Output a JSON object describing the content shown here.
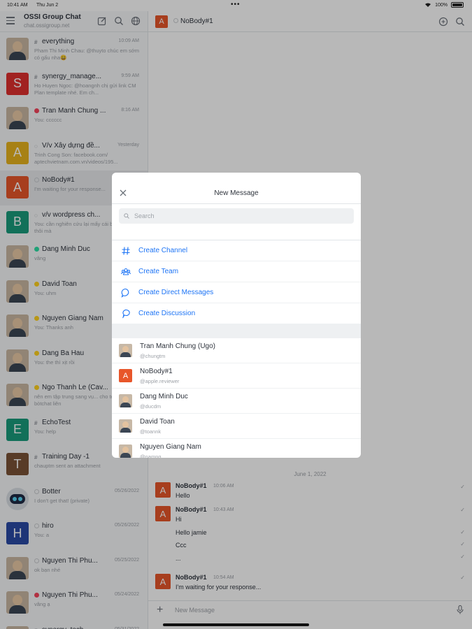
{
  "status_bar": {
    "time": "10:41 AM",
    "date": "Thu Jun 2",
    "battery": "100%"
  },
  "workspace": {
    "title": "OSSI Group Chat",
    "url": "chat.ossigroup.net"
  },
  "rooms": [
    {
      "name": "everything",
      "type": "channel",
      "time": "10:09 AM",
      "message": "Pham Thi Minh Chau: @thuyto chúc em sớm có gấu nha😄",
      "avatar": "photo"
    },
    {
      "name": "synergy_manage...",
      "type": "channel",
      "time": "9:59 AM",
      "message": "Ho Huyen Ngoc: @hoangnh chị gửi link CM Plan template nhé. Em ch...",
      "avatar": "S",
      "color": "#e0302f"
    },
    {
      "name": "Tran Manh Chung ...",
      "type": "dm",
      "status": "busy",
      "time": "8:16 AM",
      "message": "You: cccccc",
      "avatar": "photo"
    },
    {
      "name": "V/v Xây dựng đề...",
      "type": "discussion",
      "time": "Yesterday",
      "message": "Trinh Cong Son: facebook.com/ aptechvietnam.com.vn/videos/195...",
      "avatar": "A",
      "color": "#e8b31e"
    },
    {
      "name": "NoBody#1",
      "type": "dm",
      "status": "offline",
      "time": "",
      "message": "I'm waiting for your response...",
      "avatar": "A",
      "color": "#e8562a",
      "active": true
    },
    {
      "name": "v/v wordpress ch...",
      "type": "discussion",
      "time": "",
      "message": "You: cần nghiên cứu lại mấy cái backup đã thôi mà",
      "avatar": "B",
      "color": "#1a9b7c"
    },
    {
      "name": "Dang Minh Duc",
      "type": "dm",
      "status": "online",
      "time": "",
      "message": "vâng",
      "avatar": "photo"
    },
    {
      "name": "David Toan",
      "type": "dm",
      "status": "away",
      "time": "",
      "message": "You: uhm",
      "avatar": "photo"
    },
    {
      "name": "Nguyen Giang Nam",
      "type": "dm",
      "status": "away",
      "time": "",
      "message": "You: Thanks anh",
      "avatar": "photo"
    },
    {
      "name": "Dang Ba Hau",
      "type": "dm",
      "status": "away",
      "time": "",
      "message": "You: the thì xịt rồi",
      "avatar": "photo"
    },
    {
      "name": "Ngo Thanh Le (Cav...",
      "type": "dm",
      "status": "away",
      "time": "",
      "message": "nên em tập trung sang vụ... cho team, xà bòtchat liên",
      "avatar": "photo"
    },
    {
      "name": "EchoTest",
      "type": "channel",
      "time": "",
      "message": "You: help",
      "avatar": "E",
      "color": "#1a9b7c"
    },
    {
      "name": "Training Day -1",
      "type": "channel",
      "time": "",
      "message": "chauptm sent an attachment",
      "avatar": "T",
      "color": "#7a5236"
    },
    {
      "name": "Botter",
      "type": "dm",
      "status": "offline",
      "time": "05/26/2022",
      "message": "I don't get that! (private)",
      "avatar": "bot"
    },
    {
      "name": "hiro",
      "type": "dm",
      "status": "offline",
      "time": "05/26/2022",
      "message": "You: a",
      "avatar": "H",
      "color": "#2a4aa6"
    },
    {
      "name": "Nguyen Thi Phu...",
      "type": "dm",
      "status": "offline",
      "time": "05/25/2022",
      "message": "ok bạn nhé",
      "avatar": "photo"
    },
    {
      "name": "Nguyen Thi Phu...",
      "type": "dm",
      "status": "busy",
      "time": "05/24/2022",
      "message": "vâng ạ",
      "avatar": "photo"
    },
    {
      "name": "synergy_tech...",
      "type": "channel",
      "time": "05/31/2022",
      "message": "",
      "avatar": "photo"
    }
  ],
  "room_header": {
    "title": "NoBody#1",
    "avatar": "A"
  },
  "chat": {
    "day_separator": "June 1, 2022",
    "messages": [
      {
        "author": "NoBody#1",
        "time": "10:06 AM",
        "lines": [
          "Hello"
        ]
      },
      {
        "author": "NoBody#1",
        "time": "10:43 AM",
        "lines": [
          "Hi",
          "Hello jamie",
          "Ccc",
          "..."
        ]
      },
      {
        "author": "NoBody#1",
        "time": "10:54 AM",
        "lines": [
          "I'm waiting for your response..."
        ]
      }
    ]
  },
  "composer": {
    "placeholder": "New Message"
  },
  "modal": {
    "title": "New Message",
    "search_placeholder": "Search",
    "actions": [
      {
        "label": "Create Channel",
        "icon": "hash-icon"
      },
      {
        "label": "Create Team",
        "icon": "team-icon"
      },
      {
        "label": "Create Direct Messages",
        "icon": "chat-bubble-icon"
      },
      {
        "label": "Create Discussion",
        "icon": "discussion-icon"
      }
    ],
    "users": [
      {
        "name": "Tran Manh Chung (Ugo)",
        "username": "@chungtm",
        "avatar": "photo"
      },
      {
        "name": "NoBody#1",
        "username": "@apple.reviewer",
        "avatar": "A",
        "color": "#e8562a"
      },
      {
        "name": "Dang Minh Duc",
        "username": "@ducdm",
        "avatar": "photo"
      },
      {
        "name": "David Toan",
        "username": "@toannk",
        "avatar": "photo"
      },
      {
        "name": "Nguyen Giang Nam",
        "username": "@namng",
        "avatar": "photo"
      }
    ]
  },
  "colors": {
    "link": "#1d74f5",
    "online": "#2de0a5",
    "away": "#ffd21f",
    "busy": "#f5455c",
    "offline": "#cbced1"
  }
}
